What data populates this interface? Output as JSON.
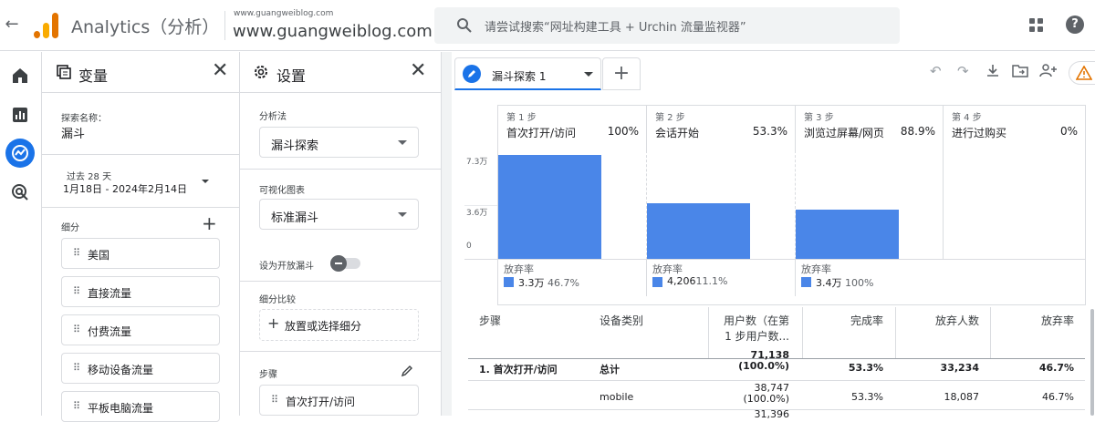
{
  "topbar": {
    "app_title": "Analytics（分析）",
    "account_small": "www.guangweiblog.com",
    "account_big": "www.guangweiblog.com",
    "search_placeholder": "请尝试搜索“网址构建工具 + Urchin 流量监视器”",
    "help_label": "?"
  },
  "nav": {
    "items": [
      "home-icon",
      "reports-icon",
      "explore-icon",
      "advertising-icon"
    ],
    "active": "explore-icon"
  },
  "variables": {
    "title": "变量",
    "exploration_name_label": "探索名称：",
    "exploration_name": "漏斗",
    "date_range_label": "过去 28 天",
    "date_range": "1月18日 - 2024年2月14日",
    "segments_label": "细分",
    "segments": [
      "美国",
      "直接流量",
      "付费流量",
      "移动设备流量",
      "平板电脑流量"
    ]
  },
  "settings": {
    "title": "设置",
    "technique_label": "分析法",
    "technique": "漏斗探索",
    "viz_label": "可视化图表",
    "viz": "标准漏斗",
    "open_funnel_label": "设为开放漏斗",
    "open_funnel_on": false,
    "segment_compare_label": "细分比较",
    "segment_compare_placeholder": "放置或选择细分",
    "steps_label": "步骤",
    "steps": [
      "首次打开/访问"
    ]
  },
  "canvas": {
    "tab_label": "漏斗探索 1",
    "add_tab": "+"
  },
  "chart_data": {
    "type": "bar",
    "y_ticks": [
      "7.3万",
      "3.6万",
      "0"
    ],
    "ylim": [
      0,
      73000
    ],
    "steps": [
      {
        "step": "第 1 步",
        "name": "首次打开/访问",
        "pct": "100%",
        "value": 71138,
        "abandon_label": "放弃率",
        "abandon_count": "3.3万",
        "abandon_rate": "46.7%"
      },
      {
        "step": "第 2 步",
        "name": "会话开始",
        "pct": "53.3%",
        "value": 37900,
        "abandon_label": "放弃率",
        "abandon_count": "4,206",
        "abandon_rate": "11.1%"
      },
      {
        "step": "第 3 步",
        "name": "浏览过屏幕/网页",
        "pct": "88.9%",
        "value": 33700,
        "abandon_label": "放弃率",
        "abandon_count": "3.4万",
        "abandon_rate": "100%"
      },
      {
        "step": "第 4 步",
        "name": "进行过购买",
        "pct": "0%",
        "value": 0,
        "abandon_label": "",
        "abandon_count": "",
        "abandon_rate": ""
      }
    ],
    "bar_color": "#4a86e8"
  },
  "table": {
    "headers": [
      "步骤",
      "设备类别",
      "用户数（在第 1 步用户数...",
      "完成率",
      "放弃人数",
      "放弃率"
    ],
    "rows": [
      {
        "step": "1. 首次打开/访问",
        "device": "总计",
        "users": "71,138",
        "users_pct": "(100.0%)",
        "completion": "53.3%",
        "abandons": "33,234",
        "abandon_rate": "46.7%",
        "bold": true
      },
      {
        "step": "",
        "device": "mobile",
        "users": "38,747",
        "users_pct": "(100.0%)",
        "completion": "53.3%",
        "abandons": "18,087",
        "abandon_rate": "46.7%",
        "bold": false
      },
      {
        "step": "",
        "device": "",
        "users": "31,396",
        "users_pct": "",
        "completion": "",
        "abandons": "",
        "abandon_rate": "",
        "bold": false
      }
    ]
  }
}
